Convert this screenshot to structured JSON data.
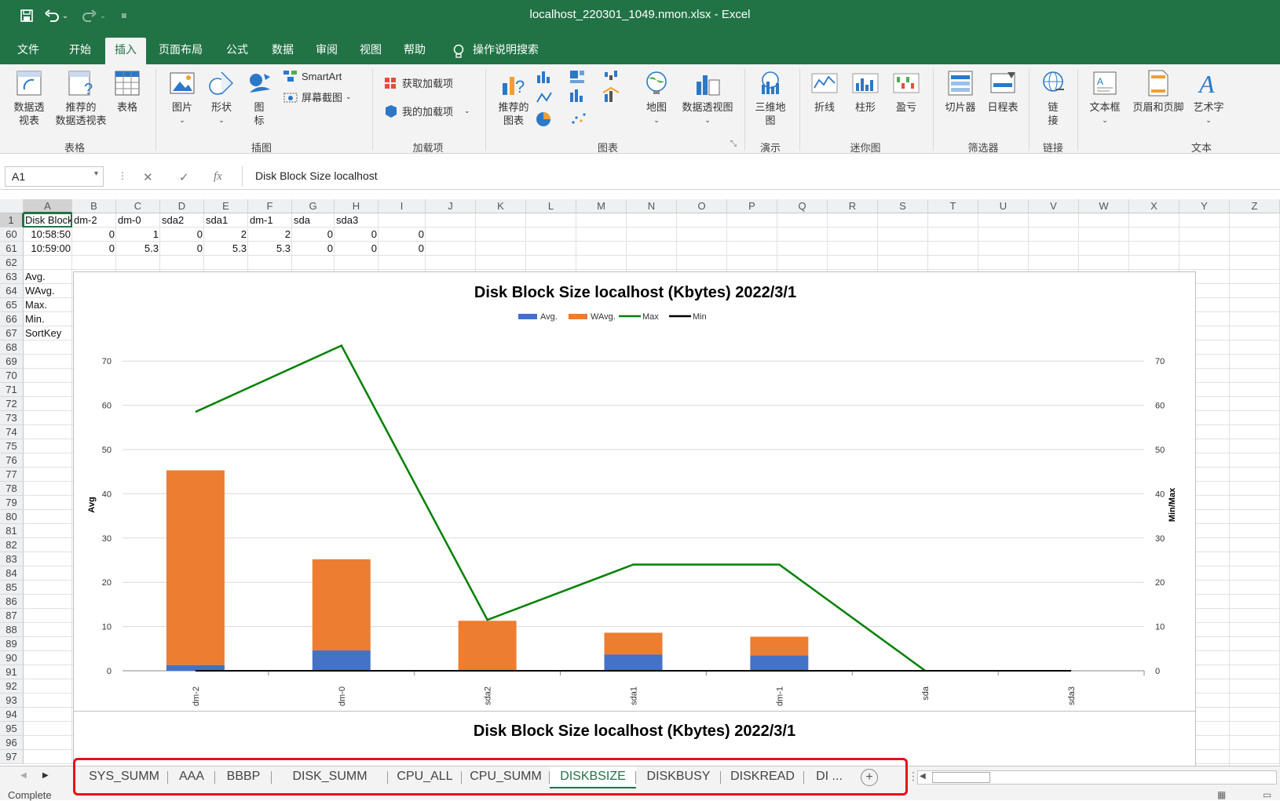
{
  "title_bar": {
    "window_title": "localhost_220301_1049.nmon.xlsx  -  Excel"
  },
  "menu_tabs": [
    "文件",
    "开始",
    "插入",
    "页面布局",
    "公式",
    "数据",
    "审阅",
    "视图",
    "帮助",
    "操作说明搜索"
  ],
  "ribbon": {
    "buttons": {
      "pivot_table": "数据透\n视表",
      "recommended_pivot": "推荐的\n数据透视表",
      "table": "表格",
      "pictures": "图片",
      "shapes": "形状",
      "icons": "图\n标",
      "smartart": "SmartArt",
      "screenshot": "屏幕截图",
      "get_addins": "获取加载项",
      "my_addins": "我的加载项",
      "recommended_charts": "推荐的\n图表",
      "maps": "地图",
      "pivot_chart": "数据透视图",
      "map_3d": "三维地\n图",
      "spark_line": "折线",
      "spark_column": "柱形",
      "spark_winloss": "盈亏",
      "slicer": "切片器",
      "timeline": "日程表",
      "link": "链\n接",
      "text_box": "文本框",
      "header_footer": "页眉和页脚",
      "wordart": "艺术字"
    },
    "groups": [
      "表格",
      "插图",
      "加载项",
      "图表",
      "演示",
      "迷你图",
      "筛选器",
      "链接",
      "文本"
    ]
  },
  "formula_bar": {
    "name_box": "A1",
    "fx": "fx",
    "formula": "Disk Block Size localhost"
  },
  "columns": [
    "A",
    "B",
    "C",
    "D",
    "E",
    "F",
    "G",
    "H",
    "I",
    "J",
    "K",
    "L",
    "M",
    "N",
    "O",
    "P",
    "Q",
    "R",
    "S",
    "T",
    "U",
    "V",
    "W",
    "X",
    "Y",
    "Z"
  ],
  "rows": [
    "1",
    "60",
    "61",
    "62",
    "63",
    "64",
    "65",
    "66",
    "67",
    "68",
    "69",
    "70",
    "71",
    "72",
    "73",
    "74",
    "75",
    "76",
    "77",
    "78",
    "79",
    "80",
    "81",
    "82",
    "83",
    "84",
    "85",
    "86",
    "87",
    "88",
    "89",
    "90",
    "91",
    "92",
    "93",
    "94",
    "95",
    "96",
    "97"
  ],
  "cells": {
    "row1": [
      "Disk Block",
      "dm-2",
      "dm-0",
      "sda2",
      "sda1",
      "dm-1",
      "sda",
      "sda3"
    ],
    "row60": [
      "10:58:50",
      "0",
      "1",
      "0",
      "2",
      "2",
      "0",
      "0",
      "0"
    ],
    "row61": [
      "10:59:00",
      "0",
      "5.3",
      "0",
      "5.3",
      "5.3",
      "0",
      "0",
      "0"
    ],
    "row63": "Avg.",
    "row64": "WAvg.",
    "row65": "Max.",
    "row66": "Min.",
    "row67": "SortKey"
  },
  "chart_data": {
    "type": "bar",
    "title": "Disk Block Size localhost (Kbytes)  2022/3/1",
    "categories": [
      "dm-2",
      "dm-0",
      "sda2",
      "sda1",
      "dm-1",
      "sda",
      "sda3"
    ],
    "series": [
      {
        "name": "Avg.",
        "kind": "stacked-bar",
        "axis": "left",
        "color": "#4472c4",
        "values": [
          1.3,
          4.6,
          0,
          3.7,
          3.5,
          0,
          0
        ]
      },
      {
        "name": "WAvg.",
        "kind": "stacked-bar",
        "axis": "left",
        "color": "#ed7d31",
        "values": [
          44,
          20.6,
          11.3,
          4.9,
          4.2,
          0,
          0
        ]
      },
      {
        "name": "Max",
        "kind": "line",
        "axis": "right",
        "color": "#008000",
        "values": [
          58.5,
          73.5,
          11.5,
          24,
          24,
          0,
          0
        ]
      },
      {
        "name": "Min",
        "kind": "line",
        "axis": "right",
        "color": "#000000",
        "values": [
          0,
          0,
          0,
          0,
          0,
          0,
          0
        ]
      }
    ],
    "ylabel": "Avg",
    "y2label": "Min/Max",
    "ylim": [
      0,
      75
    ],
    "yticks": [
      0,
      10,
      20,
      30,
      40,
      50,
      60,
      70
    ],
    "grid": true,
    "legend": "top"
  },
  "chart2_title": "Disk Block Size localhost (Kbytes)  2022/3/1",
  "sheet_tabs": {
    "tabs": [
      "SYS_SUMM",
      "AAA",
      "BBBP",
      "DISK_SUMM",
      "CPU_ALL",
      "CPU_SUMM",
      "DISKBSIZE",
      "DISKBUSY",
      "DISKREAD",
      "DI ..."
    ],
    "active": "DISKBSIZE",
    "add": "+"
  },
  "status": {
    "text": "Complete"
  }
}
